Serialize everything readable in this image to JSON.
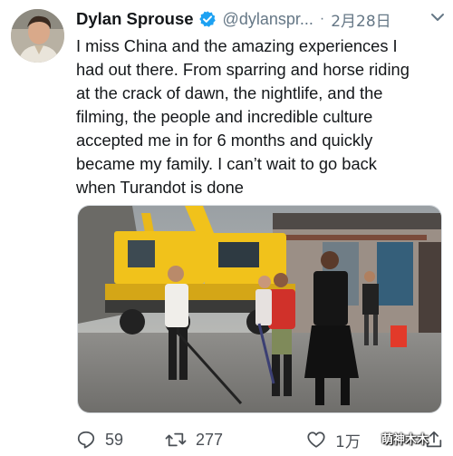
{
  "tweet": {
    "display_name": "Dylan Sprouse",
    "handle": "@dylanspr...",
    "separator": "·",
    "date": "2月28日",
    "text": "I miss China and the amazing experiences I\nhad out there. From sparring and horse riding\nat the crack of dawn, the nightlife, and the\nfilming, the people and incredible culture\naccepted me in for 6 months and quickly\nbecame my family. I can’t wait to go back\nwhen Turandot is done",
    "icons": {
      "avatar": "profile-photo",
      "verified": "verified-badge-icon",
      "caret": "chevron-down-icon",
      "reply": "reply-icon",
      "retweet": "retweet-icon",
      "like": "heart-icon",
      "share": "share-icon"
    },
    "colors": {
      "verified": "#1da1f2",
      "secondary_text": "#657786",
      "crane": "#f1c21b"
    }
  },
  "actions": {
    "reply_count": "59",
    "retweet_count": "277",
    "like_count": "1万"
  },
  "watermark": "萌神木木"
}
